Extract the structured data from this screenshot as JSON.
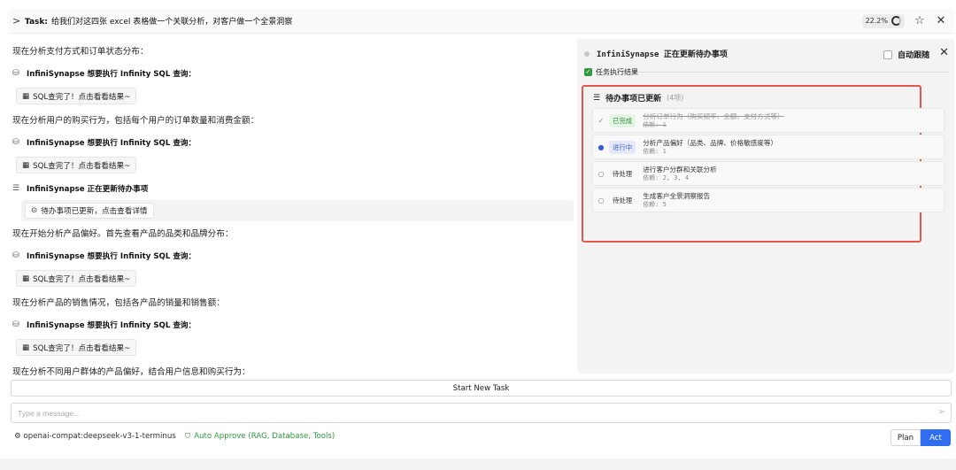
{
  "header": {
    "chevron": ">",
    "task_label": "Task:",
    "task_text": "给我们对这四张 excel 表格做一个关联分析，对客户做一个全景洞察",
    "progress": "22.2%",
    "star_icon": "star-icon",
    "close_icon": "close-icon"
  },
  "chat": {
    "m1": "现在分析支付方式和订单状态分布：",
    "m2": "InfiniSynapse 想要执行 Infinity SQL 查询：",
    "m3": "SQL查完了！点击看看结果~",
    "m4": "现在分析用户的购买行为，包括每个用户的订单数量和消费金额：",
    "m5": "InfiniSynapse 想要执行 Infinity SQL 查询：",
    "m6": "SQL查完了！点击看看结果~",
    "m7": "InfiniSynapse 正在更新待办事项",
    "m8": "待办事项已更新，点击查看详情",
    "m9": "现在开始分析产品偏好。首先查看产品的品类和品牌分布：",
    "m10": "InfiniSynapse 想要执行 Infinity SQL 查询：",
    "m11": "SQL查完了！点击看看结果~",
    "m12": "现在分析产品的销售情况，包括各产品的销量和销售额：",
    "m13": "InfiniSynapse 想要执行 Infinity SQL 查询：",
    "m14": "SQL查完了！点击看看结果~",
    "m15": "现在分析不同用户群体的产品偏好，结合用户信息和购买行为："
  },
  "panel": {
    "title": "InfiniSynapse 正在更新待办事项",
    "follow_label": "自动跟随",
    "result_label": "任务执行结果",
    "todo_title": "待办事项已更新",
    "todo_count": "(4项)",
    "items": [
      {
        "status": "已完成",
        "text": "分析订单行为（购买频率、金额、支付方式等）",
        "dep": "依赖: 1"
      },
      {
        "status": "进行中",
        "text": "分析产品偏好（品类、品牌、价格敏感度等）",
        "dep": "依赖: 1"
      },
      {
        "status": "待处理",
        "text": "进行客户分群和关联分析",
        "dep": "依赖: 2, 3, 4"
      },
      {
        "status": "待处理",
        "text": "生成客户全景洞察报告",
        "dep": "依赖: 5"
      }
    ]
  },
  "bottom": {
    "new_task": "Start New Task",
    "message_placeholder": "Type a message...",
    "model": "openai-compat:deepseek-v3-1-terminus",
    "auto_approve": "Auto Approve (RAG, Database, Tools)",
    "plan": "Plan",
    "act": "Act"
  },
  "colors": {
    "accent": "#2f6ef0",
    "highlight_border": "#e05b4b",
    "success": "#2e9a3c"
  }
}
